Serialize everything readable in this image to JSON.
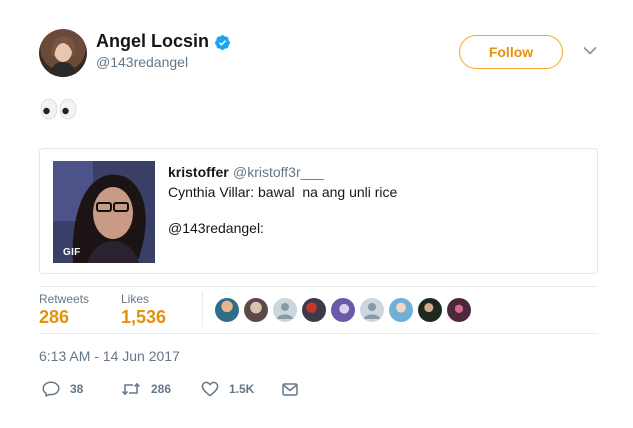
{
  "tweet": {
    "author": {
      "name": "Angel Locsin",
      "handle": "@143redangel",
      "verified": true
    },
    "follow_label": "Follow",
    "quoted": {
      "author": "kristoffer",
      "handle": "@kristoff3r___",
      "text": "Cynthia Villar: bawal  na ang unli rice",
      "mention": "@143redangel:",
      "media_badge": "GIF"
    },
    "stats": {
      "retweets_label": "Retweets",
      "retweets": "286",
      "likes_label": "Likes",
      "likes": "1,536",
      "liker_count": 9
    },
    "timestamp": "6:13 AM - 14 Jun 2017",
    "actions": {
      "replies": "38",
      "retweets": "286",
      "likes": "1.5K"
    }
  },
  "colors": {
    "accent": "#e6910c",
    "verified": "#1da1f2",
    "muted": "#657786",
    "border": "#e1e8ed"
  },
  "icons": [
    "verified-badge-icon",
    "caret-down-icon",
    "eyes-emoji-icon",
    "reply-icon",
    "retweet-icon",
    "heart-icon",
    "direct-message-icon"
  ]
}
